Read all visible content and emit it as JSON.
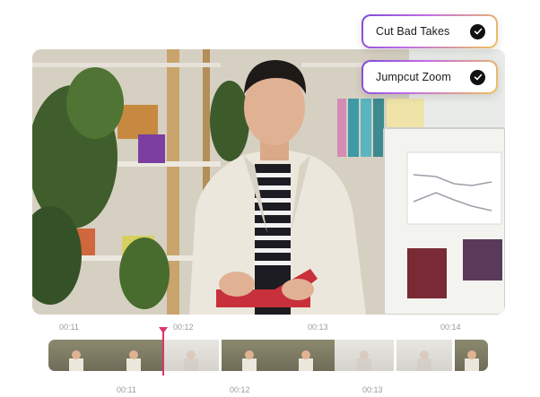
{
  "features": [
    {
      "label": "Cut Bad Takes",
      "checked": true
    },
    {
      "label": "Jumpcut Zoom",
      "checked": true
    }
  ],
  "timeline": {
    "top_ticks": [
      "00:11",
      "00:12",
      "00:13",
      "00:14"
    ],
    "bottom_ticks": [
      "00:11",
      "00:12",
      "00:13"
    ],
    "playhead_color": "#e0356b"
  },
  "video": {
    "description_icon": "presenter-video"
  }
}
